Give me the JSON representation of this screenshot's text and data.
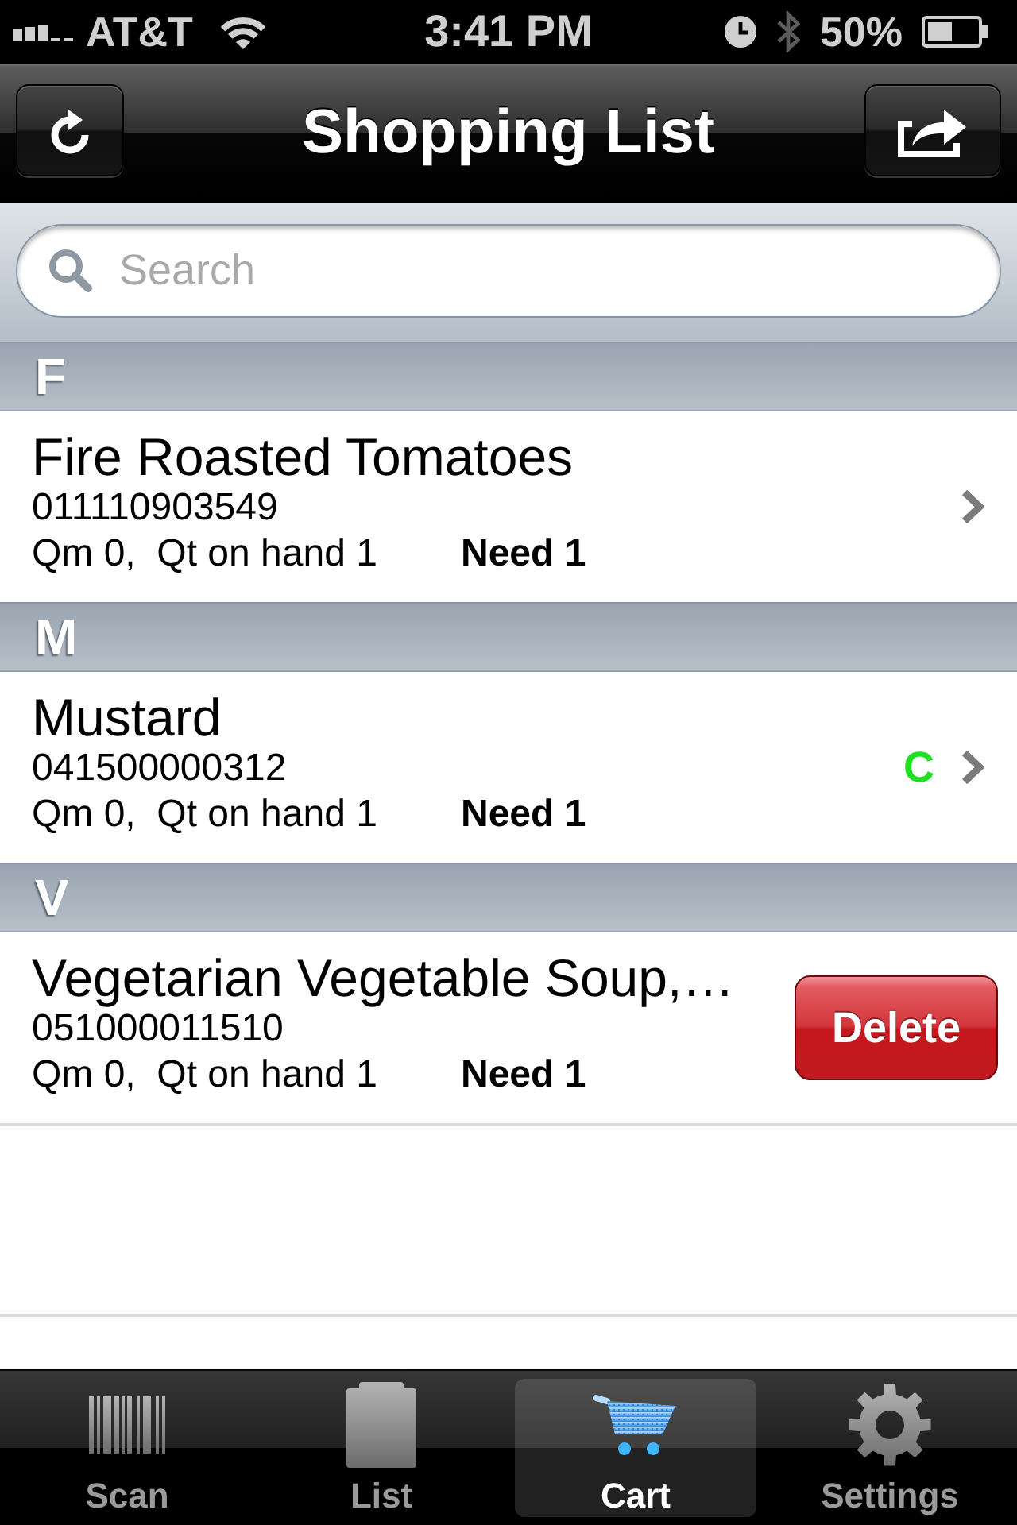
{
  "status_bar": {
    "carrier": "AT&T",
    "time": "3:41 PM",
    "battery": "50%"
  },
  "nav_bar": {
    "title": "Shopping List"
  },
  "search": {
    "placeholder": "Search"
  },
  "sections": [
    {
      "letter": "F",
      "items": [
        {
          "name": "Fire Roasted Tomatoes",
          "barcode": "011110903549",
          "quantities": "Qm 0,  Qt on hand 1",
          "need": "Need 1",
          "accessory": {
            "kind": "chevron"
          }
        }
      ]
    },
    {
      "letter": "M",
      "items": [
        {
          "name": "Mustard",
          "barcode": "041500000312",
          "quantities": "Qm 0,  Qt on hand 1",
          "need": "Need 1",
          "status": "C",
          "accessory": {
            "kind": "chevron"
          }
        }
      ]
    },
    {
      "letter": "V",
      "items": [
        {
          "name": "Vegetarian Vegetable Soup,…",
          "barcode": "051000011510",
          "quantities": "Qm 0,  Qt on hand 1",
          "need": "Need 1",
          "accessory": {
            "kind": "delete",
            "label": "Delete"
          }
        }
      ]
    }
  ],
  "tab_bar": {
    "tabs": [
      {
        "label": "Scan",
        "kind": "barcode",
        "selected": false
      },
      {
        "label": "List",
        "kind": "clipboard",
        "selected": false
      },
      {
        "label": "Cart",
        "kind": "cart",
        "selected": true
      },
      {
        "label": "Settings",
        "kind": "gear",
        "selected": false
      }
    ]
  }
}
